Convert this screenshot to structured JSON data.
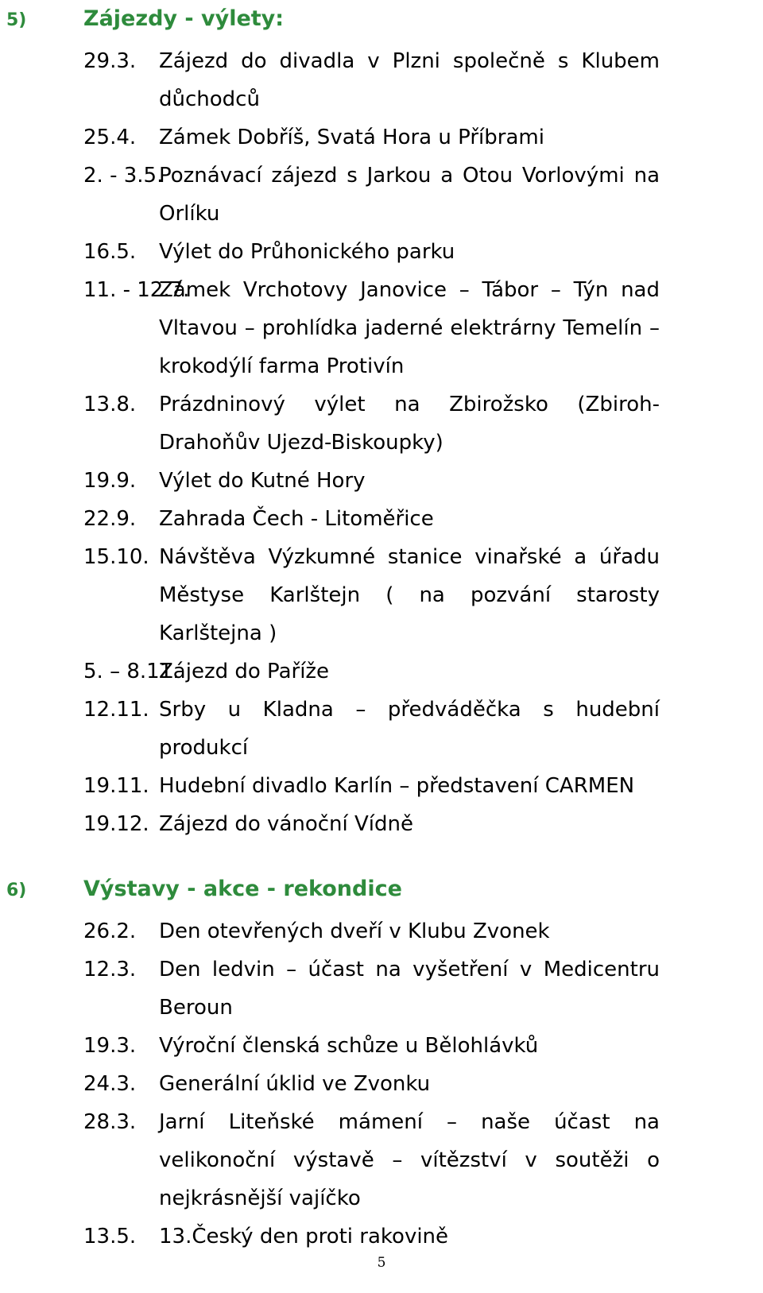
{
  "page": {
    "number": "5",
    "accent_color": "#2e8b3c",
    "text_color": "#000000",
    "background": "#ffffff"
  },
  "sections": [
    {
      "number": "5)",
      "title": "Zájezdy - výlety:",
      "entries": [
        {
          "date": "29.3.",
          "text": "Zájezd do divadla v Plzni společně s Klubem důchodců",
          "justify": true
        },
        {
          "date": "25.4.",
          "text": "Zámek Dobříš, Svatá Hora u Příbrami",
          "justify": false
        },
        {
          "date": "2. - 3.5.",
          "text": "Poznávací zájezd s Jarkou a Otou Vorlovými na Orlíku",
          "justify": true
        },
        {
          "date": "16.5.",
          "text": "Výlet do Průhonického parku",
          "justify": false
        },
        {
          "date": "11. - 12.7.",
          "text": "Zámek Vrchotovy Janovice – Tábor – Týn nad Vltavou – prohlídka jaderné elektrárny Temelín – krokodýlí farma Protivín",
          "justify": true
        },
        {
          "date": "13.8.",
          "text": "Prázdninový výlet na Zbirožsko (Zbiroh-Drahoňův Ujezd-Biskoupky)",
          "justify": true
        },
        {
          "date": "19.9.",
          "text": "Výlet do Kutné Hory",
          "justify": false
        },
        {
          "date": "22.9.",
          "text": "Zahrada Čech - Litoměřice",
          "justify": false
        },
        {
          "date": "15.10.",
          "text": "Návštěva Výzkumné stanice vinařské a úřadu Městyse Karlštejn ( na pozvání starosty Karlštejna )",
          "justify": true
        },
        {
          "date": "5. – 8.11.",
          "text": "Zájezd do Paříže",
          "justify": false
        },
        {
          "date": "12.11.",
          "text": "Srby u Kladna – předváděčka s hudební produkcí",
          "justify": true
        },
        {
          "date": "19.11.",
          "text": "Hudební divadlo Karlín – představení CARMEN",
          "justify": true
        },
        {
          "date": "19.12.",
          "text": "Zájezd do vánoční Vídně",
          "justify": false
        }
      ]
    },
    {
      "number": "6)",
      "title": "Výstavy - akce - rekondice",
      "entries": [
        {
          "date": "26.2.",
          "text": "Den otevřených dveří v Klubu Zvonek",
          "justify": false
        },
        {
          "date": "12.3.",
          "text": "Den ledvin – účast na vyšetření v Medicentru Beroun",
          "justify": true
        },
        {
          "date": "19.3.",
          "text": "Výroční členská schůze u Bělohlávků",
          "justify": false
        },
        {
          "date": "24.3.",
          "text": "Generální úklid ve Zvonku",
          "justify": false
        },
        {
          "date": "28.3.",
          "text": "Jarní Liteňské mámení – naše účast na velikonoční výstavě – vítězství v soutěži o nejkrásnější vajíčko",
          "justify": true
        },
        {
          "date": "13.5.",
          "text": "13.Český den proti rakovině",
          "justify": false
        }
      ]
    }
  ]
}
